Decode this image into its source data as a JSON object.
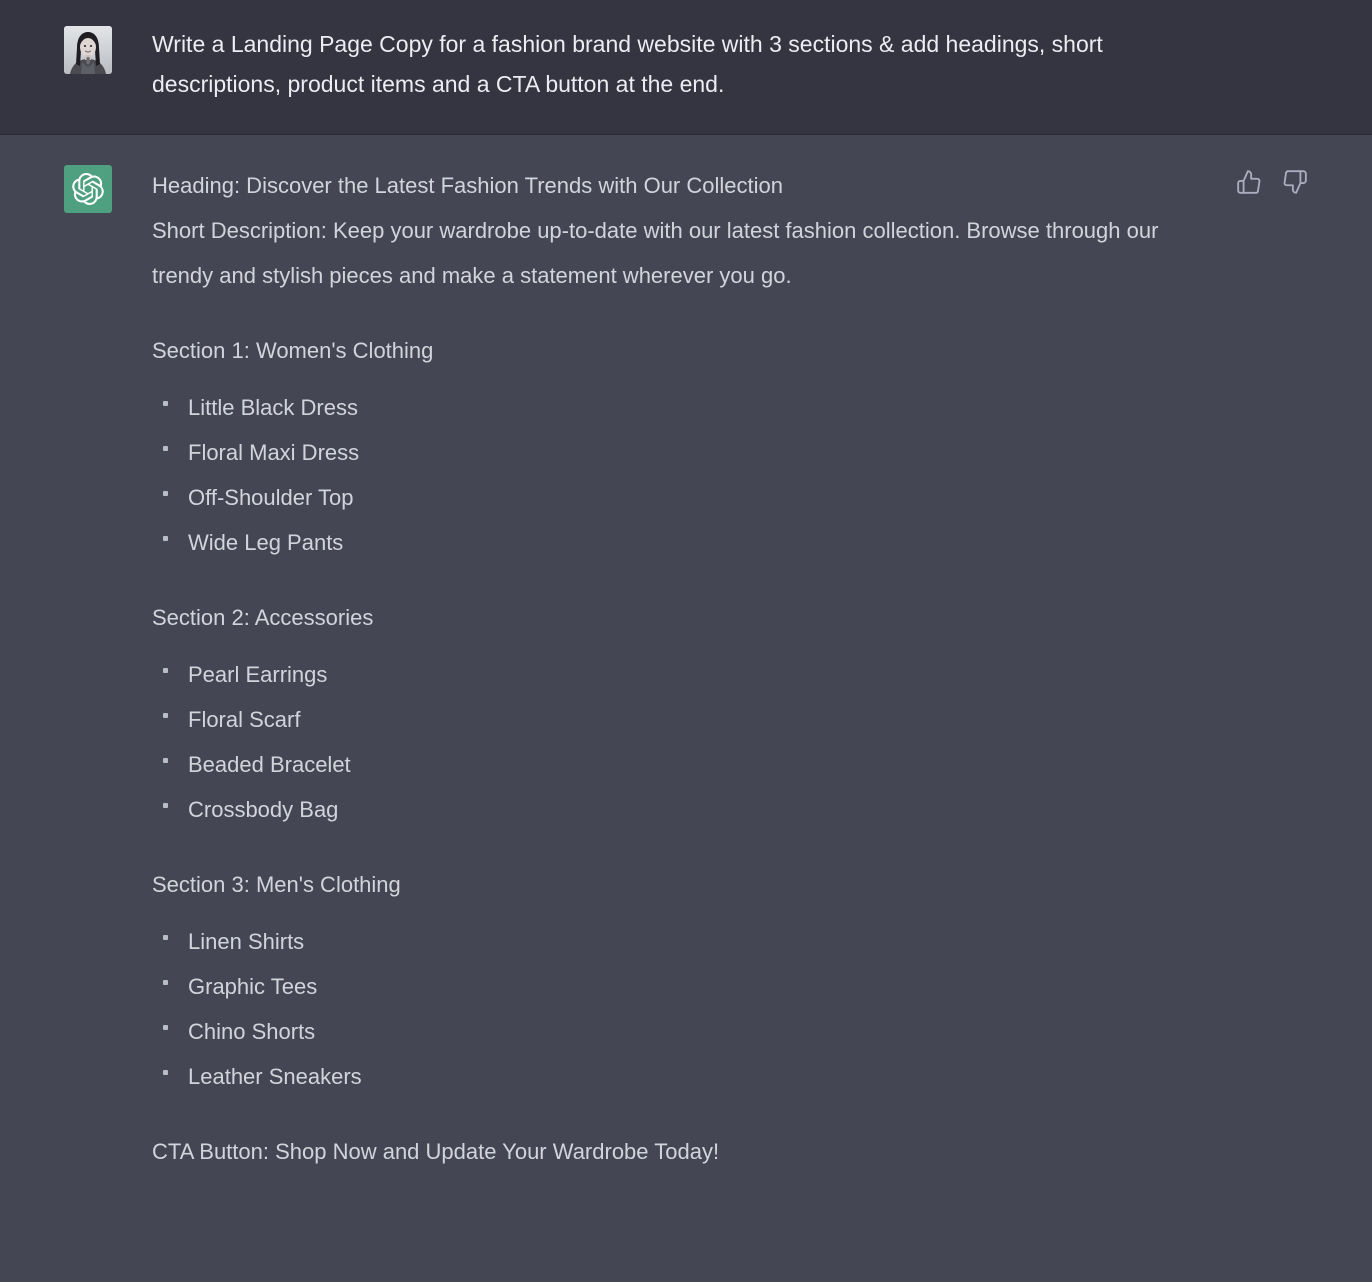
{
  "theme": {
    "user_bg": "#343541",
    "assistant_bg": "#444654",
    "text_color": "#d1d5db",
    "user_text_color": "#ececf1",
    "accent_green": "#4fa081",
    "divider": "#2a2b32"
  },
  "user_message": {
    "avatar_name": "user-avatar-photo",
    "text": "Write a Landing Page Copy for a fashion brand website with 3 sections & add headings, short descriptions, product items and a CTA button at the end."
  },
  "assistant_message": {
    "avatar_name": "chatgpt-logo",
    "heading_line": "Heading: Discover the Latest Fashion Trends with Our Collection",
    "description_line": "Short Description: Keep your wardrobe up-to-date with our latest fashion collection. Browse through our trendy and stylish pieces and make a statement wherever you go.",
    "sections": [
      {
        "heading": "Section 1: Women's Clothing",
        "items": [
          "Little Black Dress",
          "Floral Maxi Dress",
          "Off-Shoulder Top",
          "Wide Leg Pants"
        ]
      },
      {
        "heading": "Section 2: Accessories",
        "items": [
          "Pearl Earrings",
          "Floral Scarf",
          "Beaded Bracelet",
          "Crossbody Bag"
        ]
      },
      {
        "heading": "Section 3: Men's Clothing",
        "items": [
          "Linen Shirts",
          "Graphic Tees",
          "Chino Shorts",
          "Leather Sneakers"
        ]
      }
    ],
    "cta_line": "CTA Button: Shop Now and Update Your Wardrobe Today!",
    "feedback": {
      "thumbs_up_name": "thumbs-up-icon",
      "thumbs_down_name": "thumbs-down-icon"
    }
  }
}
